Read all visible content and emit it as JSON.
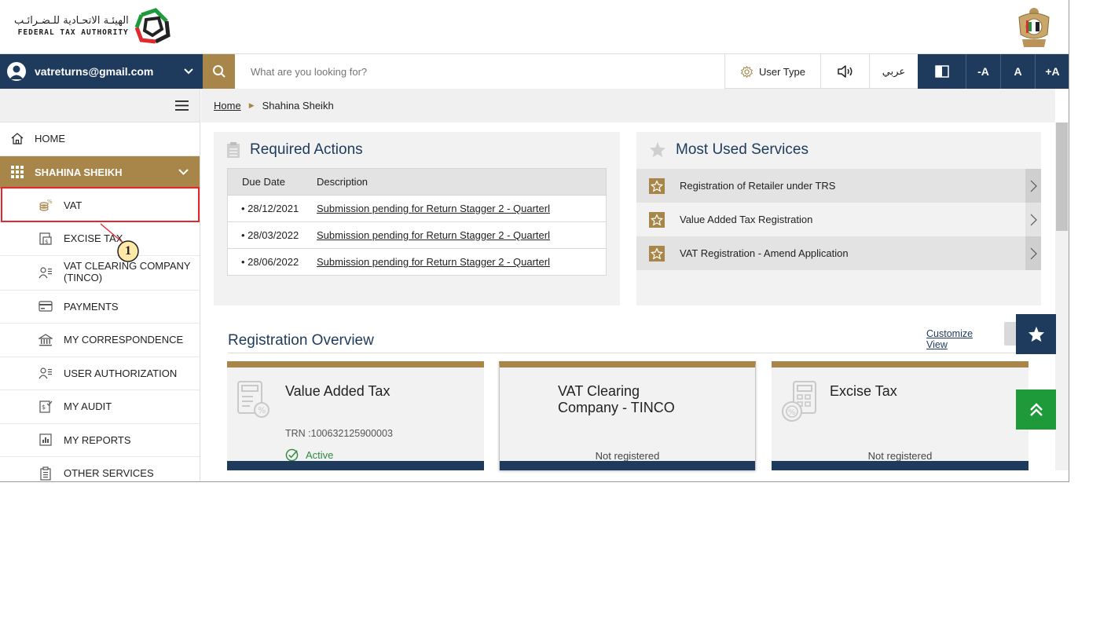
{
  "header": {
    "logo_arabic": "الهيئـة الاتحـادية للـضـرائـب",
    "logo_english": "FEDERAL TAX AUTHORITY"
  },
  "topbar": {
    "user_email": "vatreturns@gmail.com",
    "search_placeholder": "What are you looking for?",
    "user_type_label": "User Type",
    "arabic_label": "عربي",
    "font_decrease": "-A",
    "font_reset": "A",
    "font_increase": "+A"
  },
  "sidebar": {
    "home": "HOME",
    "group": "SHAHINA SHEIKH",
    "items": [
      {
        "label": "VAT",
        "icon": "vat-coins-icon"
      },
      {
        "label": "EXCISE TAX",
        "icon": "excise-icon"
      },
      {
        "label": "VAT CLEARING COMPANY",
        "label2": "(TINCO)",
        "icon": "tinco-user-icon"
      },
      {
        "label": "PAYMENTS",
        "icon": "payments-card-icon"
      },
      {
        "label": "MY CORRESPONDENCE",
        "icon": "bank-icon"
      },
      {
        "label": "USER AUTHORIZATION",
        "icon": "user-authorization-icon"
      },
      {
        "label": "MY AUDIT",
        "icon": "audit-icon"
      },
      {
        "label": "MY REPORTS",
        "icon": "reports-icon"
      },
      {
        "label": "OTHER SERVICES",
        "icon": "clipboard-icon"
      }
    ],
    "callout_number": "1"
  },
  "breadcrumb": {
    "home": "Home",
    "current": "Shahina Sheikh"
  },
  "required_actions": {
    "title": "Required Actions",
    "col_date": "Due Date",
    "col_desc": "Description",
    "rows": [
      {
        "date": "• 28/12/2021",
        "desc": "Submission pending for Return Stagger 2 - Quarterl"
      },
      {
        "date": "• 28/03/2022",
        "desc": "Submission pending for Return Stagger 2 - Quarterl"
      },
      {
        "date": "• 28/06/2022",
        "desc": "Submission pending for Return Stagger 2 - Quarterl"
      }
    ]
  },
  "most_used": {
    "title": "Most Used Services",
    "items": [
      "Registration of Retailer under TRS",
      "Value Added Tax Registration",
      "VAT Registration - Amend Application"
    ]
  },
  "registration_overview": {
    "title": "Registration Overview",
    "customize_line1": "Customize",
    "customize_line2": "View",
    "cards": [
      {
        "title": "Value Added Tax",
        "trn": "TRN :100632125900003",
        "status": "Active"
      },
      {
        "title_line1": "VAT Clearing",
        "title_line2": "Company - TINCO",
        "status": "Not registered"
      },
      {
        "title": "Excise Tax",
        "status": "Not registered"
      }
    ]
  },
  "colors": {
    "navy": "#1e3a5c",
    "gold": "#a8864a",
    "green": "#1f9a3b",
    "highlight_red": "#e0282e"
  }
}
